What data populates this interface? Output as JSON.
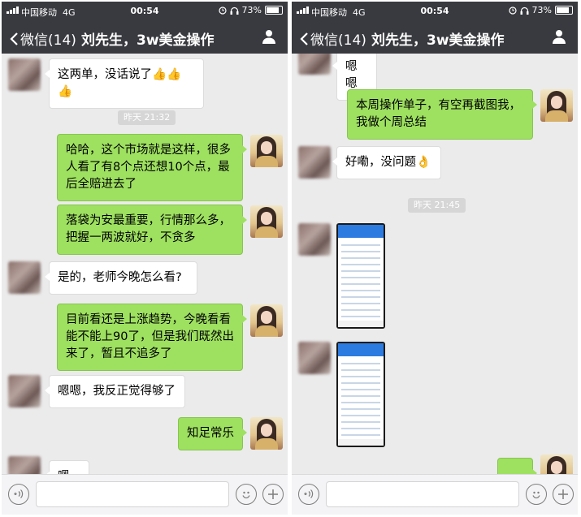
{
  "status": {
    "carrier": "中国移动",
    "network": "4G",
    "time": "00:54",
    "battery": "73%"
  },
  "nav": {
    "back_label": "微信(14)",
    "title": "刘先生，3w美金操作"
  },
  "left_chat": {
    "msg1": "这两单，没话说了👍👍👍",
    "time1": "昨天 21:32",
    "msg2": "哈哈，这个市场就是这样，很多人看了有8个点还想10个点，最后全赔进去了",
    "msg3": "落袋为安最重要，行情那么多，把握一两波就好，不贪多",
    "msg4": "是的，老师今晚怎么看?",
    "msg5": "目前看还是上涨趋势，今晚看看能不能上90了，但是我们既然出来了，暂且不追多了",
    "msg6": "嗯嗯，我反正觉得够了",
    "msg7": "知足常乐",
    "msg8": "嗯嗯"
  },
  "right_chat": {
    "msg1": "嗯嗯",
    "msg2": "本周操作单子，有空再截图我，我做个周总结",
    "msg3": "好嘞，没问题👌",
    "time1": "昨天 21:45"
  },
  "icons": [
    "signal-icon",
    "alarm-icon",
    "headphones-icon",
    "battery-icon",
    "back-chevron-icon",
    "user-icon",
    "voice-icon",
    "emoji-icon",
    "plus-icon"
  ]
}
